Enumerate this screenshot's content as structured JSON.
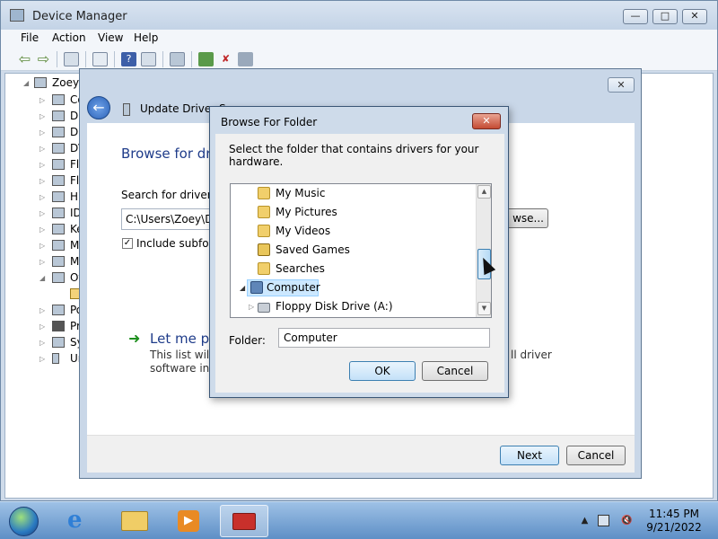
{
  "device_manager": {
    "title": "Device Manager",
    "menu": [
      "File",
      "Action",
      "View",
      "Help"
    ],
    "tree": {
      "root": "Zoey-",
      "items": [
        "Co",
        "Di",
        "Di",
        "DV",
        "Fl",
        "Fl",
        "Hu",
        "ID",
        "Ke",
        "M",
        "M",
        "Ot",
        "",
        "Po",
        "Pr",
        "Sy",
        "Ur"
      ]
    }
  },
  "wizard": {
    "title": "Update Driver S",
    "heading": "Browse for dri",
    "search_label": "Search for driver so",
    "path_value": "C:\\Users\\Zoey\\Do",
    "include_subfolders": "Include subfold",
    "browse_button": "wse...",
    "letme_heading": "Let me pi",
    "letme_desc_line1": "This list will s",
    "letme_desc_line1_tail": "ll driver",
    "letme_desc_line2": "software in t",
    "next_button": "Next",
    "cancel_button": "Cancel"
  },
  "browse_dialog": {
    "title": "Browse For Folder",
    "instruction": "Select the folder that contains drivers for your hardware.",
    "folders": [
      "My Music",
      "My Pictures",
      "My Videos",
      "Saved Games",
      "Searches",
      "Computer",
      "Floppy Disk Drive (A:)"
    ],
    "selected": "Computer",
    "folder_label": "Folder:",
    "folder_value": "Computer",
    "ok_button": "OK",
    "cancel_button": "Cancel"
  },
  "taskbar": {
    "time": "11:45 PM",
    "date": "9/21/2022"
  },
  "colors": {
    "accent": "#3c7fb1",
    "selection": "#cce8ff",
    "link_green": "#1e8f1e"
  }
}
